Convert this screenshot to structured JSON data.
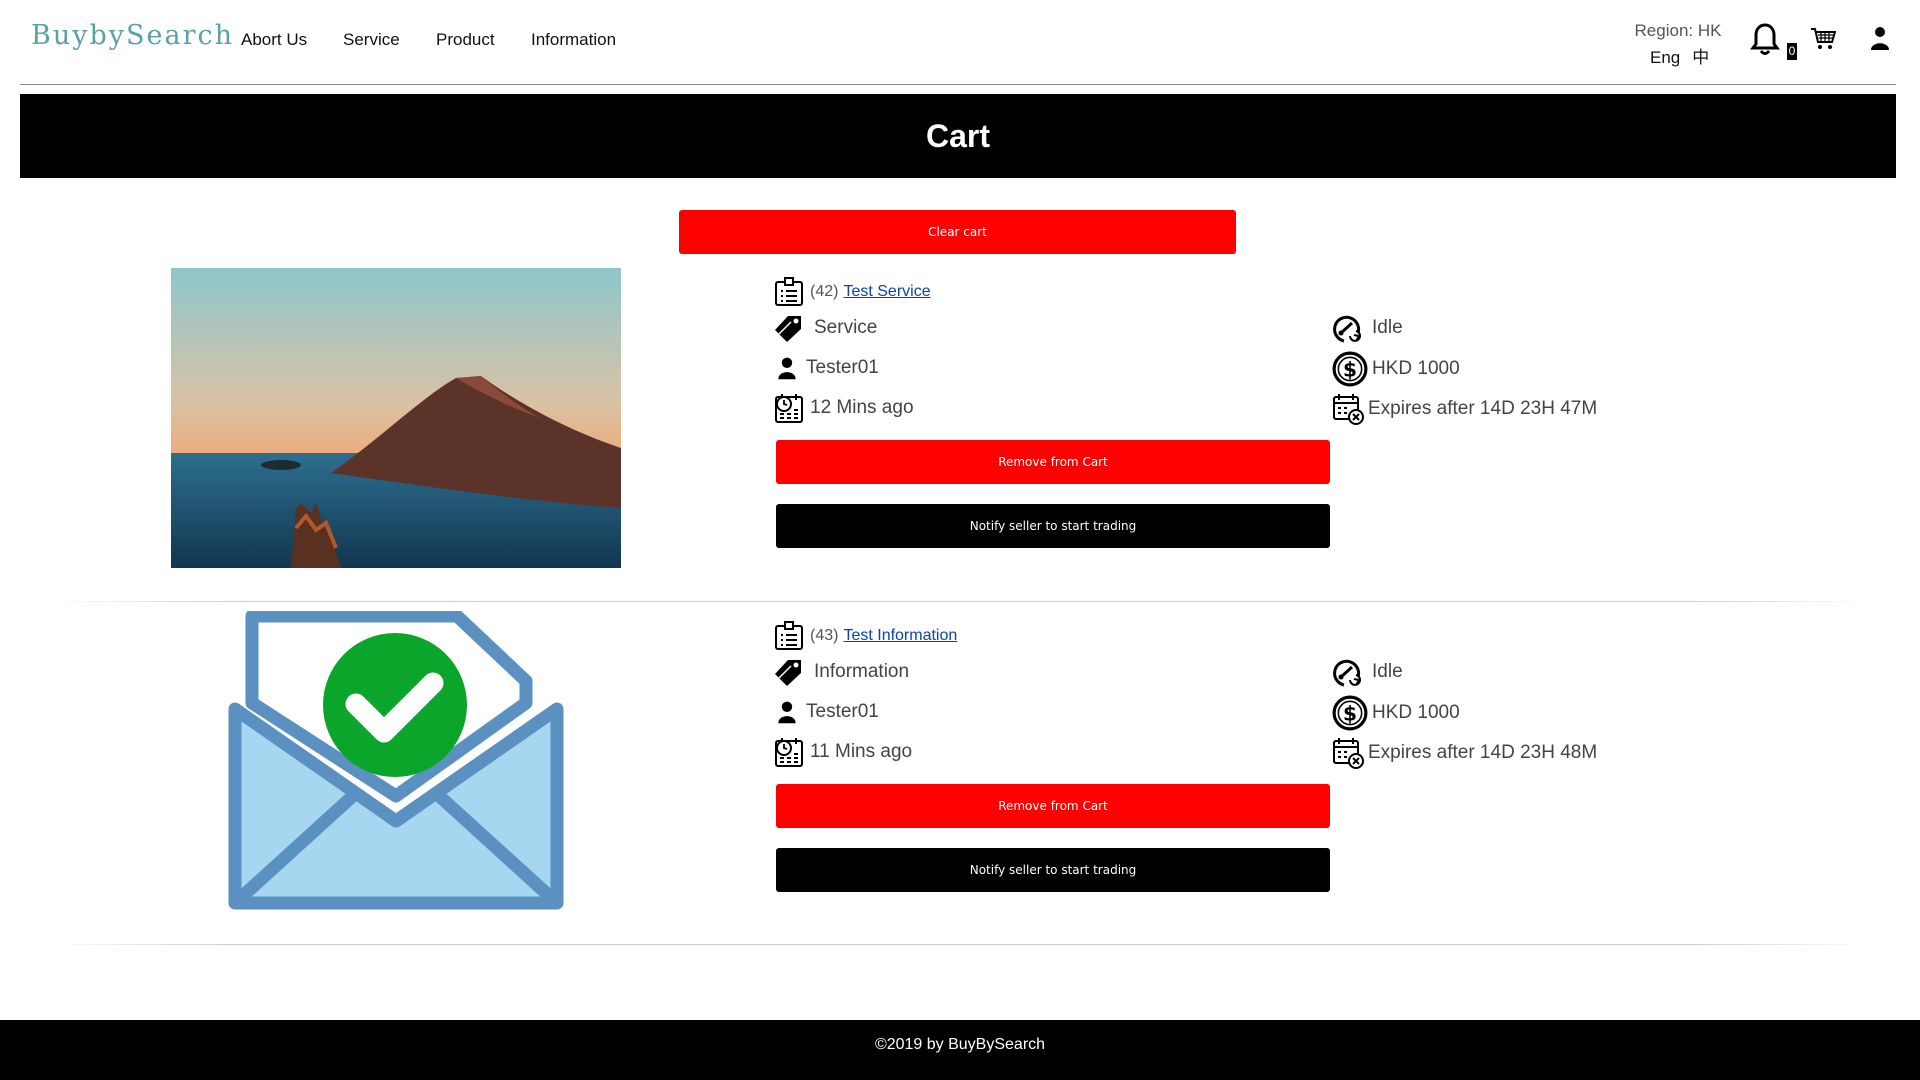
{
  "header": {
    "logo": "BuybySearch",
    "menu": [
      "Abort Us",
      "Service",
      "Product",
      "Information"
    ],
    "region": "Region: HK",
    "lang_en": "Eng",
    "lang_zh": "中",
    "cart_count": "0"
  },
  "page_title": "Cart",
  "clear_label": "Clear cart",
  "items": [
    {
      "id": "(42)",
      "title": "Test Service",
      "category": "Service",
      "seller": "Tester01",
      "posted": "12 Mins ago",
      "status": "Idle",
      "price": "HKD 1000",
      "expires": "Expires after 14D 23H 47M",
      "remove_label": "Remove from Cart",
      "notify_label": "Notify seller to start trading",
      "image": "mountain-photo"
    },
    {
      "id": "(43)",
      "title": "Test Information",
      "category": "Information",
      "seller": "Tester01",
      "posted": "11 Mins ago",
      "status": "Idle",
      "price": "HKD 1000",
      "expires": "Expires after 14D 23H 48M",
      "remove_label": "Remove from Cart",
      "notify_label": "Notify seller to start trading",
      "image": "envelope-check-icon"
    }
  ],
  "footer": "©2019 by BuyBySearch",
  "colors": {
    "accent_red": "#ff0000",
    "banner": "#000000",
    "logo": "#5aa0a8"
  }
}
